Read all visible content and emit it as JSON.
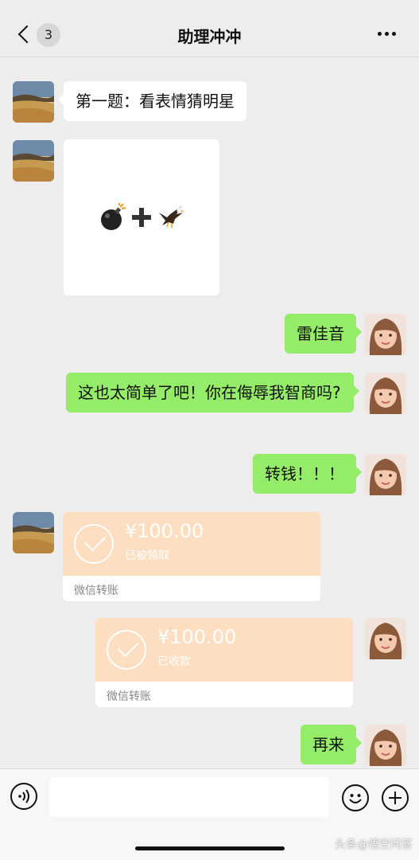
{
  "header": {
    "back_count": "3",
    "title": "助理冲冲"
  },
  "messages": {
    "m1": "第一题：看表情猜明星",
    "m2": "雷佳音",
    "m3": "这也太简单了吧！你在侮辱我智商吗?",
    "m4": "转钱！！！",
    "m5": "再来"
  },
  "transfers": [
    {
      "amount": "¥100.00",
      "status": "已被领取",
      "footer": "微信转账"
    },
    {
      "amount": "¥100.00",
      "status": "已收款",
      "footer": "微信转账"
    }
  ],
  "input": {
    "value": ""
  },
  "watermark": "头条@悟空问答",
  "colors": {
    "background": "#ededed",
    "my_bubble": "#95ec69",
    "their_bubble": "#ffffff",
    "transfer": "#fedec0"
  },
  "icons": [
    "chevron-left-icon",
    "more-icon",
    "bomb-icon",
    "plus-sign-icon",
    "eagle-icon",
    "check-icon",
    "voice-icon",
    "emoji-icon",
    "plus-icon"
  ]
}
